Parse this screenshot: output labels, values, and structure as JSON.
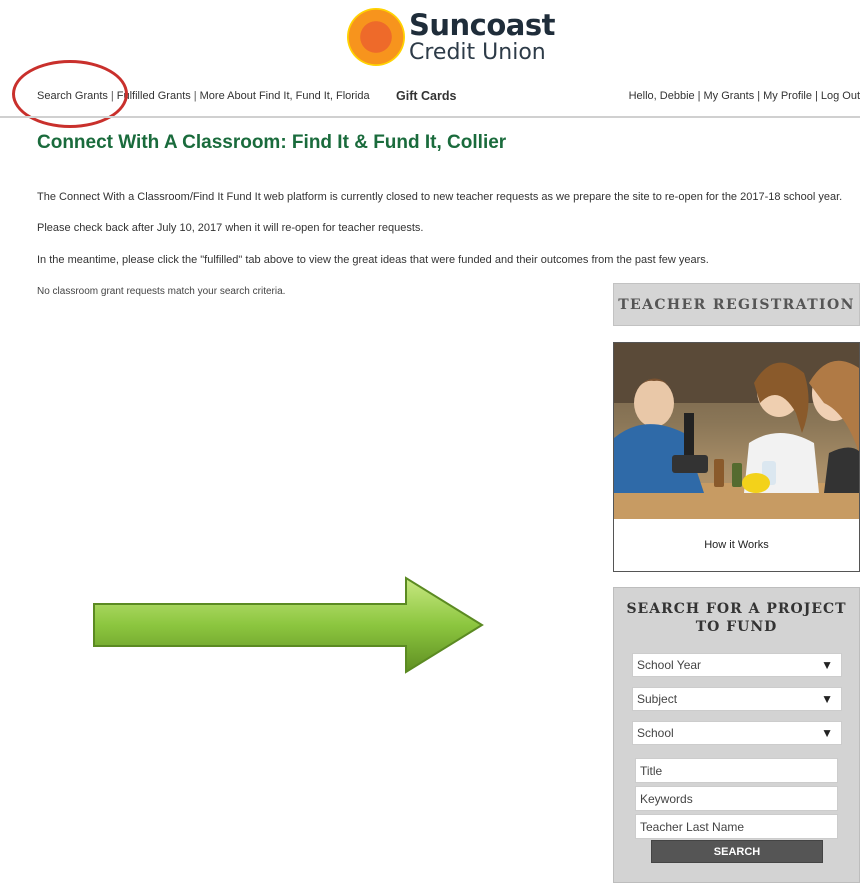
{
  "logo": {
    "line1": "Suncoast",
    "line2": "Credit Union"
  },
  "topnav": {
    "items": [
      "Search Grants",
      "Fulfilled Grants",
      "More About Find It, Fund It, Florida"
    ],
    "gift_cards": "Gift Cards"
  },
  "usernav": {
    "greeting": "Hello, Debbie",
    "items": [
      "My Grants",
      "My Profile",
      "Log Out"
    ]
  },
  "page": {
    "title": "Connect With A Classroom: Find It & Fund It, Collier",
    "paragraphs": [
      "The Connect With a Classroom/Find It Fund It web platform is currently closed to new teacher requests as we prepare the site to re-open for the 2017-18 school year.",
      "Please check back after July 10, 2017 when it will re-open for teacher requests.",
      "In the meantime, please click the \"fulfilled\" tab above to view the great ideas that were funded and their outcomes from the past few years."
    ],
    "no_results": "No classroom grant requests match your search criteria."
  },
  "sidebar": {
    "teacher_registration": "TEACHER REGISTRATION",
    "how_it_works": "How it Works",
    "search": {
      "title": "SEARCH FOR A PROJECT TO FUND",
      "selects": [
        "School Year",
        "Subject",
        "School"
      ],
      "inputs": [
        "Title",
        "Keywords",
        "Teacher Last Name"
      ],
      "button": "SEARCH"
    }
  },
  "colors": {
    "title_green": "#1a6b3c",
    "annotation_red": "#c9302c",
    "arrow_green": "#8cc63f"
  }
}
